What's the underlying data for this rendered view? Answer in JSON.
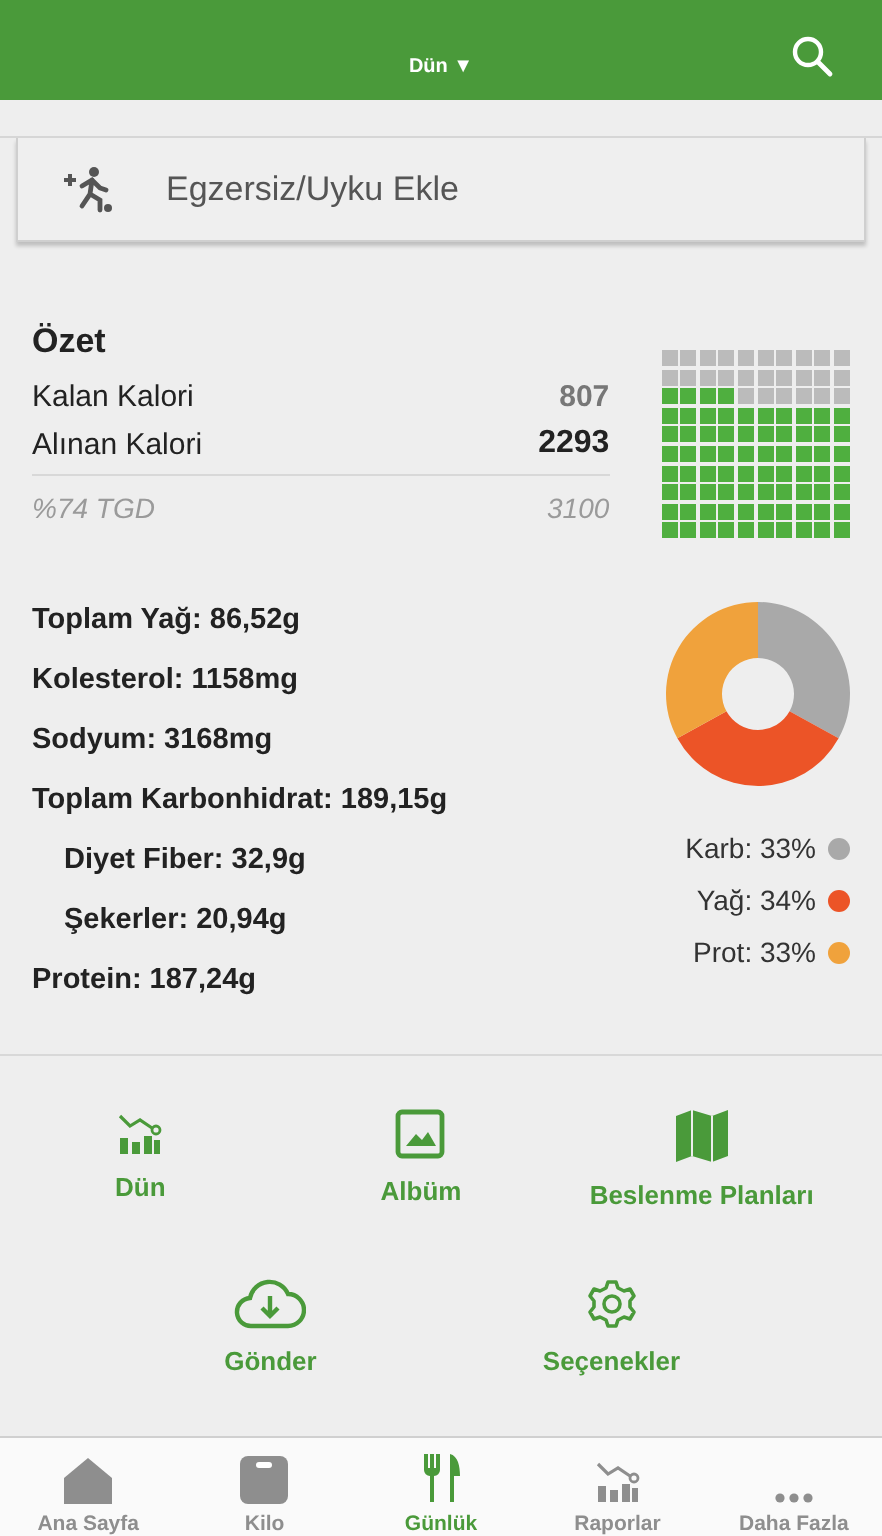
{
  "header": {
    "title": "Dün",
    "dropdown": "▼"
  },
  "add_exercise": {
    "label": "Egzersiz/Uyku Ekle"
  },
  "summary": {
    "title": "Özet",
    "rows": [
      {
        "label": "Kalan Kalori",
        "value": "807",
        "kind": "muted"
      },
      {
        "label": "Alınan Kalori",
        "value": "2293",
        "kind": "strong"
      },
      {
        "label": "%74 TGD",
        "value": "3100",
        "kind": "italic"
      }
    ]
  },
  "nutrients": [
    {
      "text": "Toplam Yağ: 86,52g",
      "indent": false
    },
    {
      "text": "Kolesterol: 1158mg",
      "indent": false
    },
    {
      "text": "Sodyum: 3168mg",
      "indent": false
    },
    {
      "text": "Toplam Karbonhidrat: 189,15g",
      "indent": false
    },
    {
      "text": "Diyet Fiber: 32,9g",
      "indent": true
    },
    {
      "text": "Şekerler: 20,94g",
      "indent": true
    },
    {
      "text": "Protein: 187,24g",
      "indent": false
    }
  ],
  "macros": {
    "chart_data": {
      "type": "donut",
      "categories": [
        "Karb: 33%",
        "Yağ: 34%",
        "Prot: 33%"
      ],
      "values": [
        33,
        34,
        33
      ]
    },
    "legend": [
      {
        "color": "#a9a9a9"
      },
      {
        "color": "#ec5427"
      },
      {
        "color": "#f0a23c"
      }
    ]
  },
  "actions": [
    {
      "label": "Dün",
      "kind": "chart"
    },
    {
      "label": "Albüm",
      "kind": "image"
    },
    {
      "label": "Beslenme Planları",
      "kind": "map"
    },
    {
      "label": "Gönder",
      "kind": "cloud"
    },
    {
      "label": "Seçenekler",
      "kind": "gear"
    }
  ],
  "tabs": [
    {
      "label": "Ana Sayfa",
      "kind": "home",
      "selected": false
    },
    {
      "label": "Kilo",
      "kind": "scale",
      "selected": false
    },
    {
      "label": "Günlük",
      "kind": "food",
      "selected": true
    },
    {
      "label": "Raporlar",
      "kind": "chart",
      "selected": false
    },
    {
      "label": "Daha Fazla",
      "kind": "more",
      "selected": false
    }
  ]
}
